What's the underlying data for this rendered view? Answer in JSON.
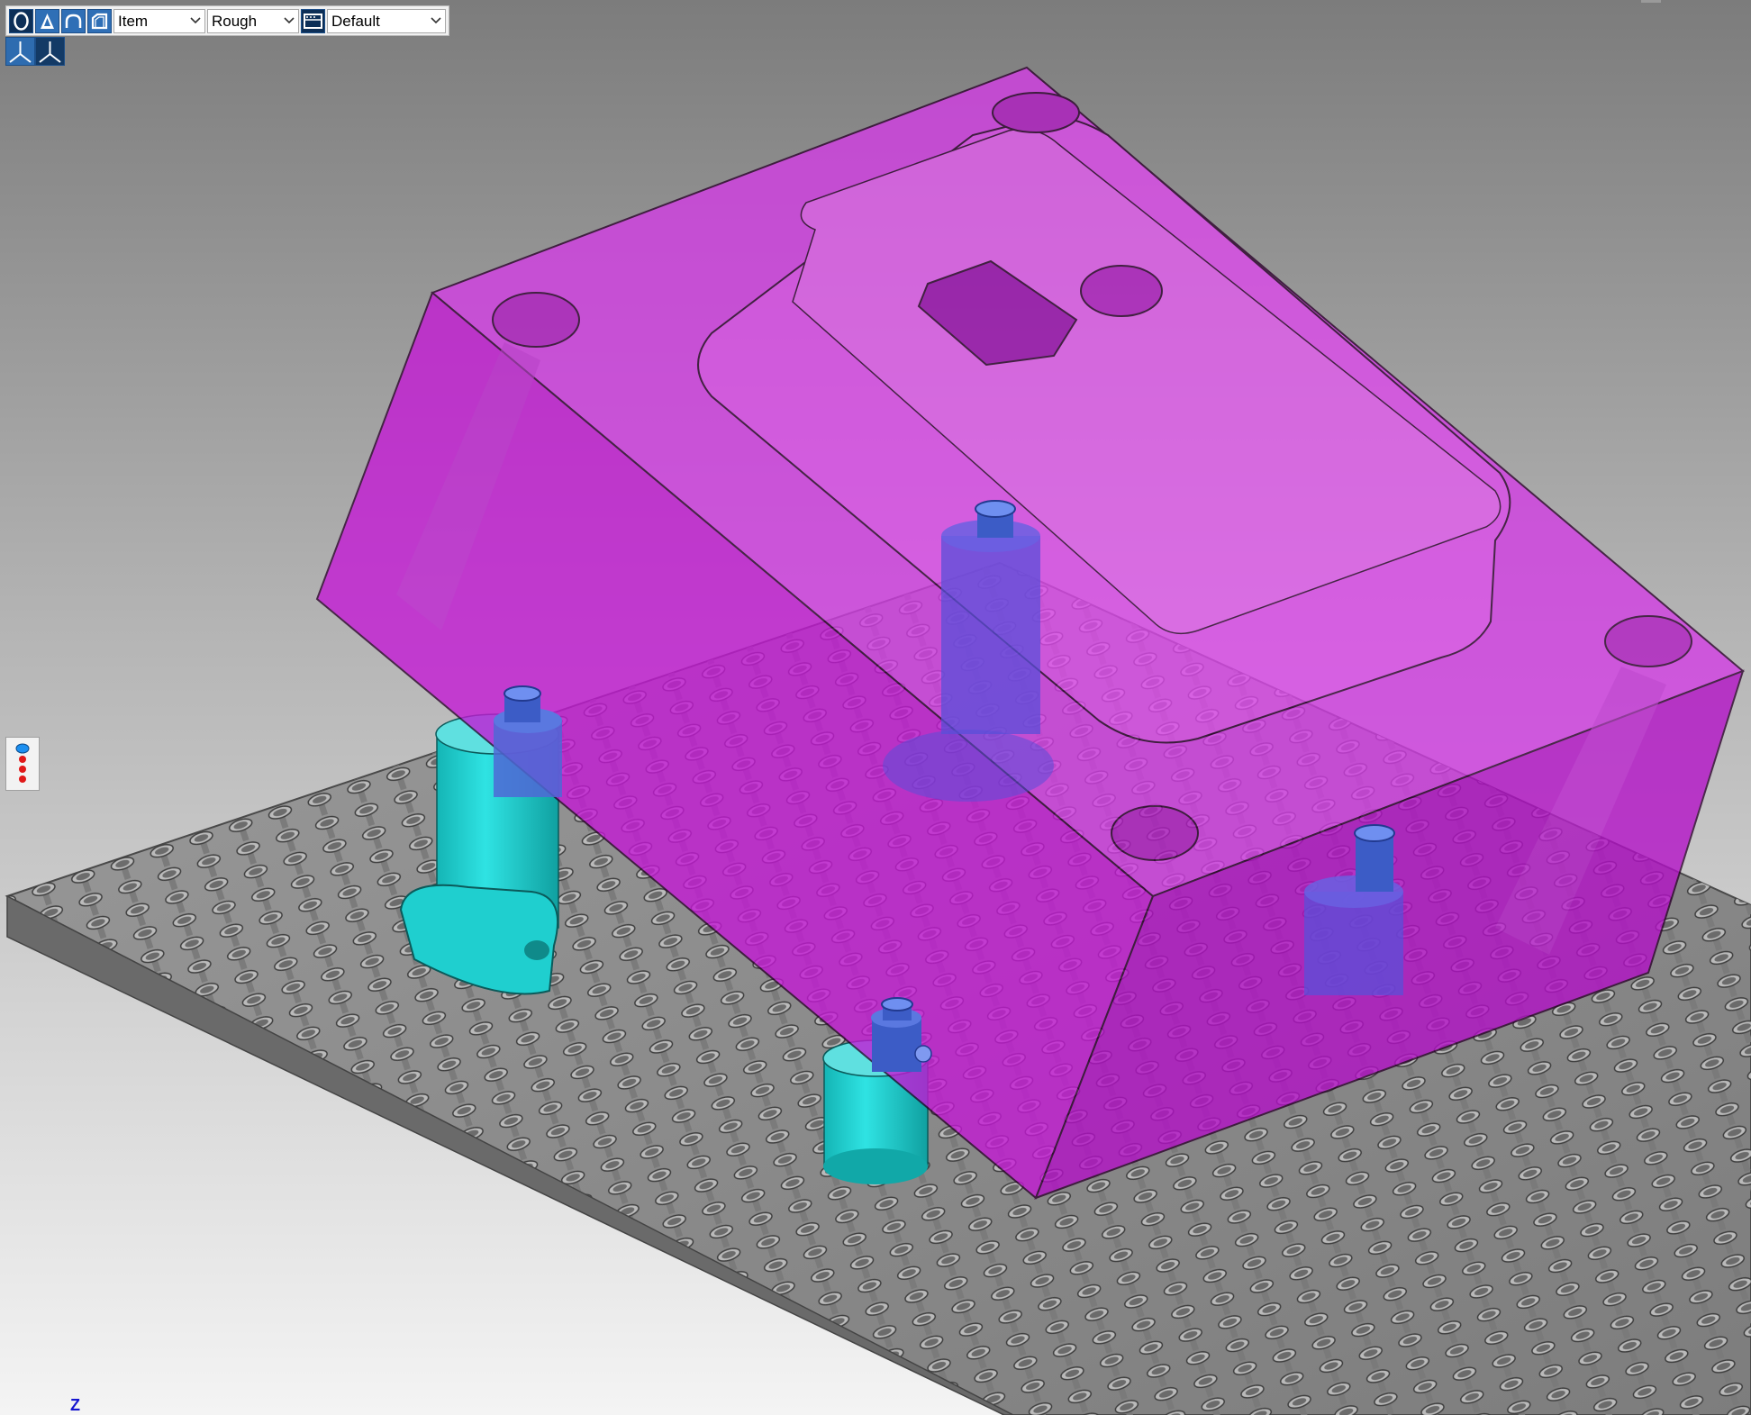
{
  "toolbar": {
    "view_mode_buttons": [
      {
        "name": "shaded-icon",
        "active": true
      },
      {
        "name": "shaded-edges-icon",
        "active": false
      },
      {
        "name": "hidden-line-icon",
        "active": false
      },
      {
        "name": "wireframe-icon",
        "active": false
      }
    ],
    "selection_filter": "Item",
    "quality": "Rough",
    "view_style_icon": "display-style-icon",
    "view_style": "Default",
    "orientation_buttons": [
      {
        "name": "axis-triad-icon"
      },
      {
        "name": "axis-triad-alt-icon"
      }
    ]
  },
  "side_widget": {
    "icon": "layers-icon"
  },
  "axis_indicator": {
    "label": "Z"
  },
  "colors": {
    "background_top": "#8a8a8a",
    "background_bottom": "#f2f2f2",
    "part_magenta": "#d41ee0",
    "fixture_cyan": "#1ecfcf",
    "pin_blue": "#3c63c8",
    "plate_gray": "#8c8c8c",
    "toolbar_button_blue": "#2f6fb6"
  }
}
